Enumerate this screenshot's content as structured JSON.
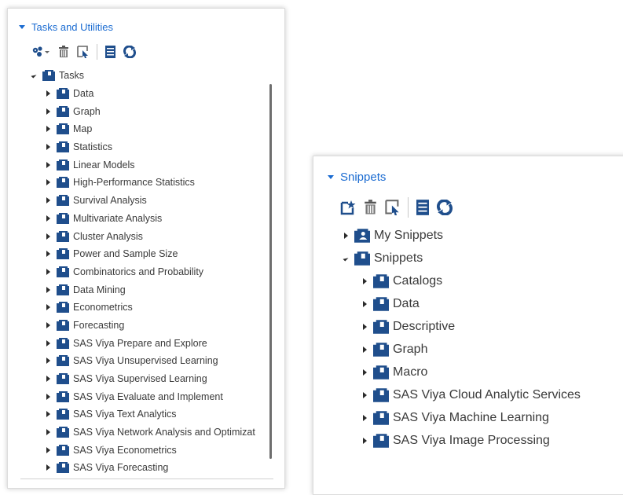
{
  "tasks_panel": {
    "header": "Tasks and Utilities",
    "toolbar": [
      "tasks-menu-icon",
      "delete-icon",
      "properties-icon",
      "view-icon",
      "refresh-icon"
    ],
    "root": "Tasks",
    "items": [
      "Data",
      "Graph",
      "Map",
      "Statistics",
      "Linear Models",
      "High-Performance Statistics",
      "Survival Analysis",
      "Multivariate Analysis",
      "Cluster Analysis",
      "Power and Sample Size",
      "Combinatorics and Probability",
      "Data Mining",
      "Econometrics",
      "Forecasting",
      "SAS Viya Prepare and Explore",
      "SAS Viya Unsupervised Learning",
      "SAS Viya Supervised Learning",
      "SAS Viya Evaluate and Implement",
      "SAS Viya Text Analytics",
      "SAS Viya Network Analysis and Optimizat",
      "SAS Viya Econometrics",
      "SAS Viya Forecasting"
    ]
  },
  "snippets_panel": {
    "header": "Snippets",
    "toolbar": [
      "new-snippet-icon",
      "delete-icon",
      "properties-icon",
      "view-icon",
      "refresh-icon"
    ],
    "my_snippets": "My Snippets",
    "root": "Snippets",
    "items": [
      "Catalogs",
      "Data",
      "Descriptive",
      "Graph",
      "Macro",
      "SAS Viya Cloud Analytic Services",
      "SAS Viya Machine Learning",
      "SAS Viya Image Processing"
    ]
  },
  "colors": {
    "accent": "#1a6bd1",
    "folder": "#1f4e8c"
  }
}
